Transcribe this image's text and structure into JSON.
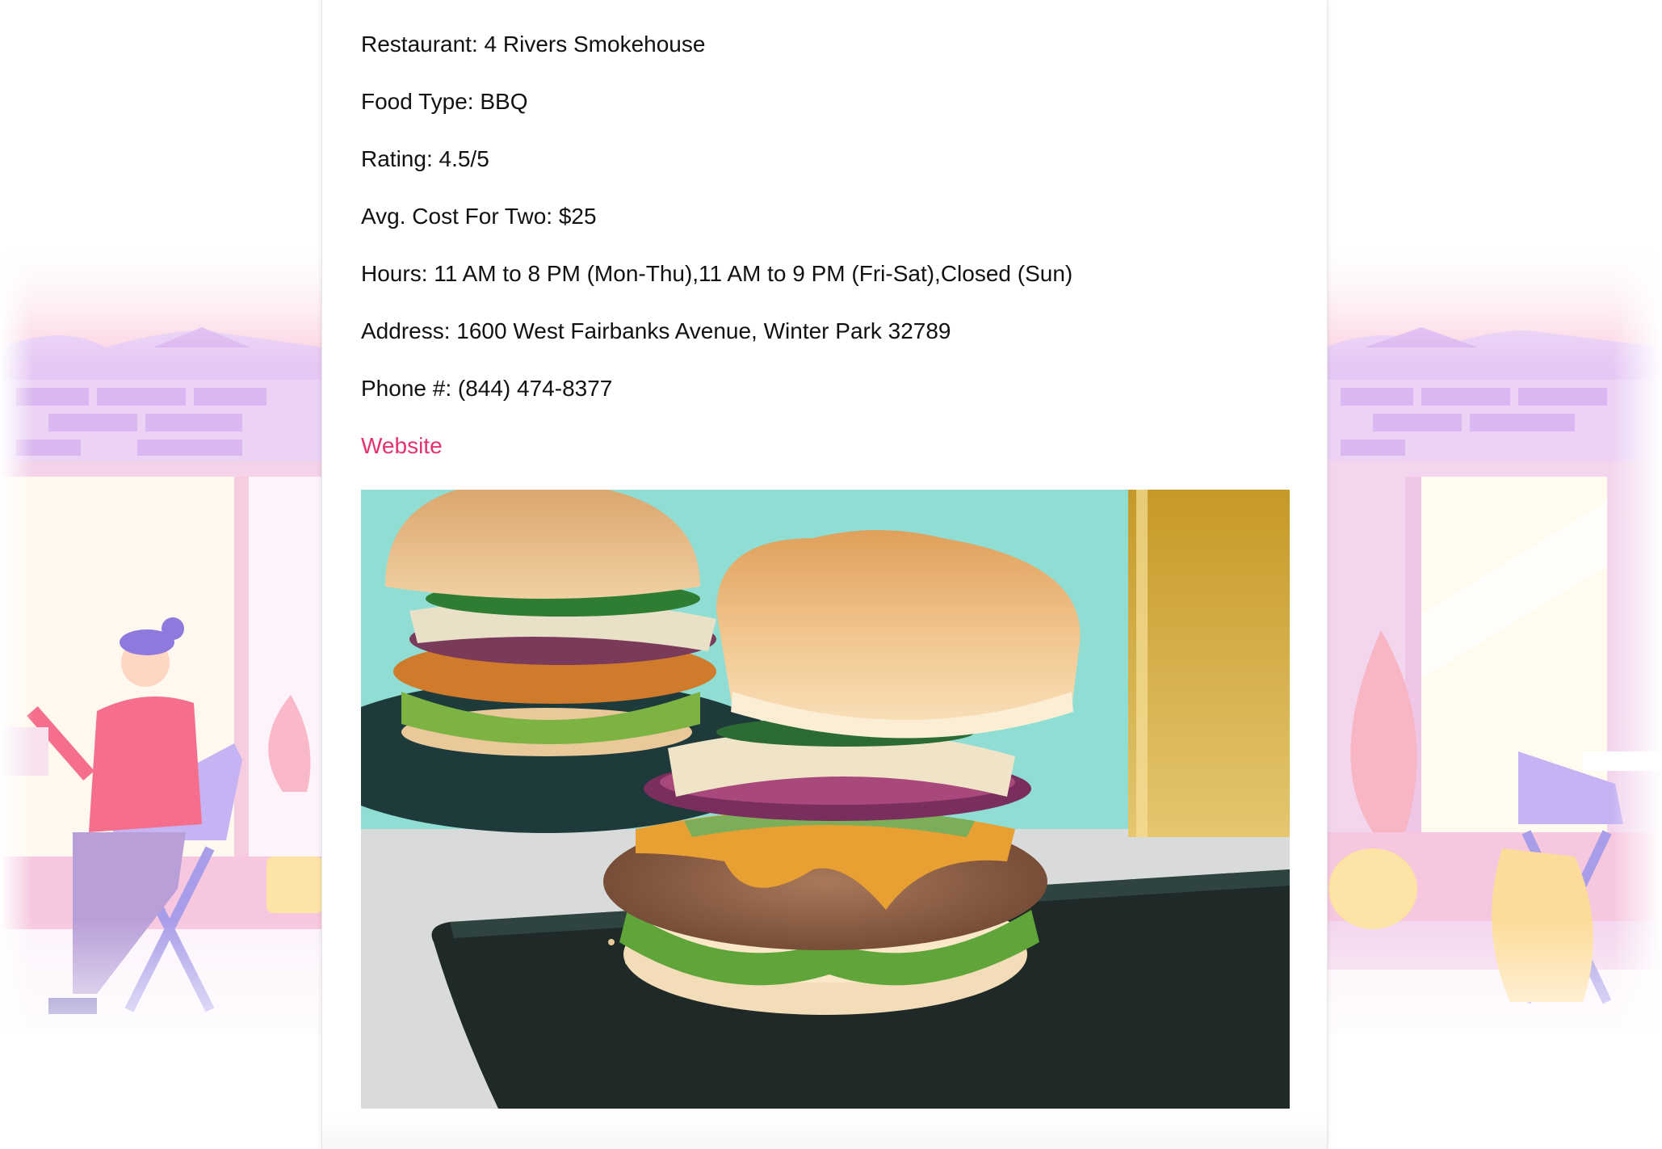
{
  "restaurant": {
    "name_label": "Restaurant:",
    "name": "4 Rivers Smokehouse",
    "food_type_label": "Food Type:",
    "food_type": "BBQ",
    "rating_label": "Rating:",
    "rating": "4.5/5",
    "cost_label": "Avg. Cost For Two:",
    "cost": "$25",
    "hours_label": "Hours:",
    "hours": "11 AM to 8 PM (Mon-Thu),11 AM to 9 PM (Fri-Sat),Closed (Sun)",
    "address_label": "Address:",
    "address": "1600 West Fairbanks Avenue, Winter Park 32789",
    "phone_label": "Phone #:",
    "phone": "(844) 474-8377",
    "website_label": "Website"
  },
  "colors": {
    "link": "#e5326e",
    "text": "#111111",
    "background_awning": "#fbd3e2",
    "background_wall": "#e6c8f4"
  },
  "images": {
    "food_photo": "burger-photo",
    "background": "restaurant-illustration"
  }
}
